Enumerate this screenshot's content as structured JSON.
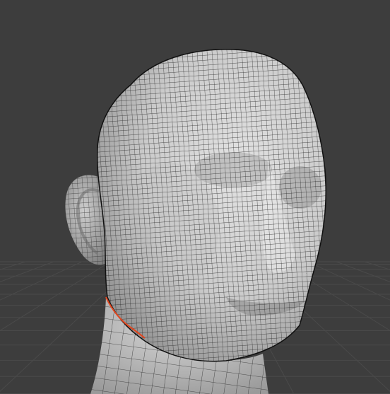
{
  "viewport": {
    "type": "3d-viewport",
    "background_color": "#3d3d3d",
    "grid_line_color": "#4a4a4a"
  },
  "mesh": {
    "object": "head",
    "surface_color": "#cfcfcf",
    "shadow_color": "#6f6f6f",
    "wire_color": "#1e1e1e",
    "selected_edge_color": "#e2461e"
  }
}
